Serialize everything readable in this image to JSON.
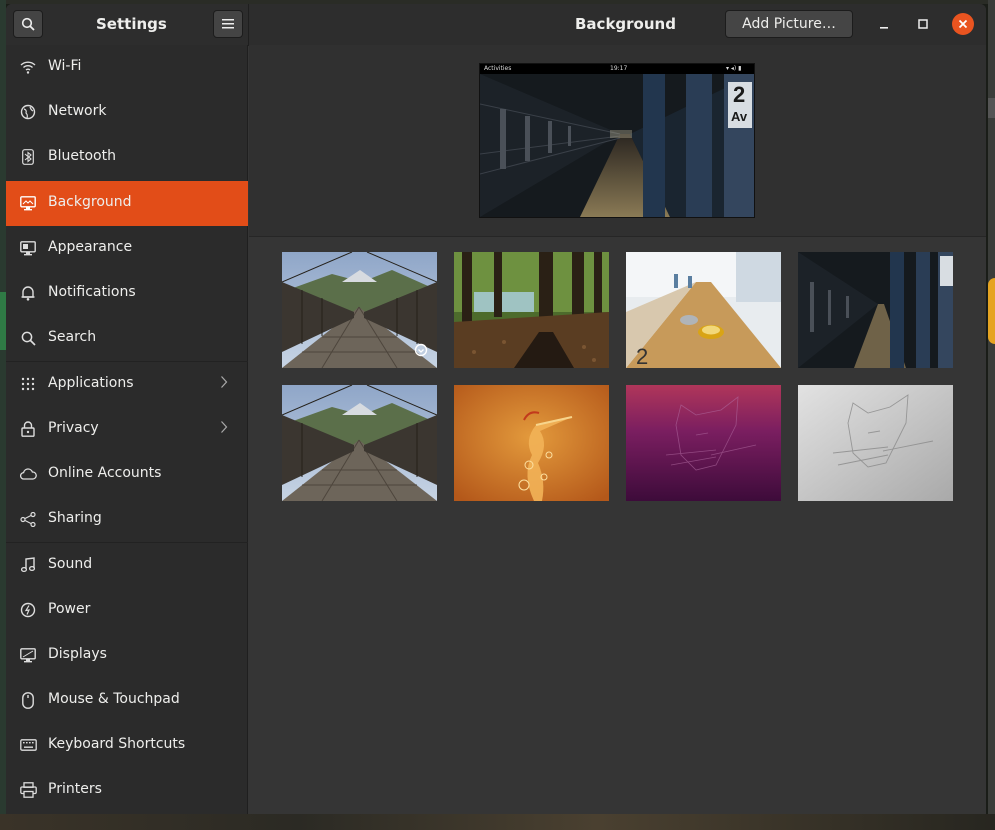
{
  "header": {
    "sidebar_title": "Settings",
    "page_title": "Background",
    "add_button": "Add Picture…"
  },
  "sidebar": {
    "items": [
      {
        "label": "Wi-Fi",
        "icon": "wifi-icon"
      },
      {
        "label": "Network",
        "icon": "network-icon"
      },
      {
        "label": "Bluetooth",
        "icon": "bluetooth-icon"
      },
      {
        "label": "Background",
        "icon": "background-icon",
        "active": true
      },
      {
        "label": "Appearance",
        "icon": "appearance-icon"
      },
      {
        "label": "Notifications",
        "icon": "notifications-icon"
      },
      {
        "label": "Search",
        "icon": "search-icon"
      },
      {
        "label": "Applications",
        "icon": "applications-icon",
        "chevron": true
      },
      {
        "label": "Privacy",
        "icon": "privacy-icon",
        "chevron": true
      },
      {
        "label": "Online Accounts",
        "icon": "online-accounts-icon"
      },
      {
        "label": "Sharing",
        "icon": "sharing-icon"
      },
      {
        "label": "Sound",
        "icon": "sound-icon"
      },
      {
        "label": "Power",
        "icon": "power-icon"
      },
      {
        "label": "Displays",
        "icon": "displays-icon"
      },
      {
        "label": "Mouse & Touchpad",
        "icon": "mouse-icon"
      },
      {
        "label": "Keyboard Shortcuts",
        "icon": "keyboard-icon"
      },
      {
        "label": "Printers",
        "icon": "printer-icon"
      }
    ]
  },
  "preview": {
    "topbar_left": "Activities",
    "topbar_clock": "19:17"
  },
  "colors": {
    "accent": "#e24d18",
    "close_button": "#e95420",
    "sidebar_bg": "#2b2b2b",
    "content_bg": "#353535"
  }
}
